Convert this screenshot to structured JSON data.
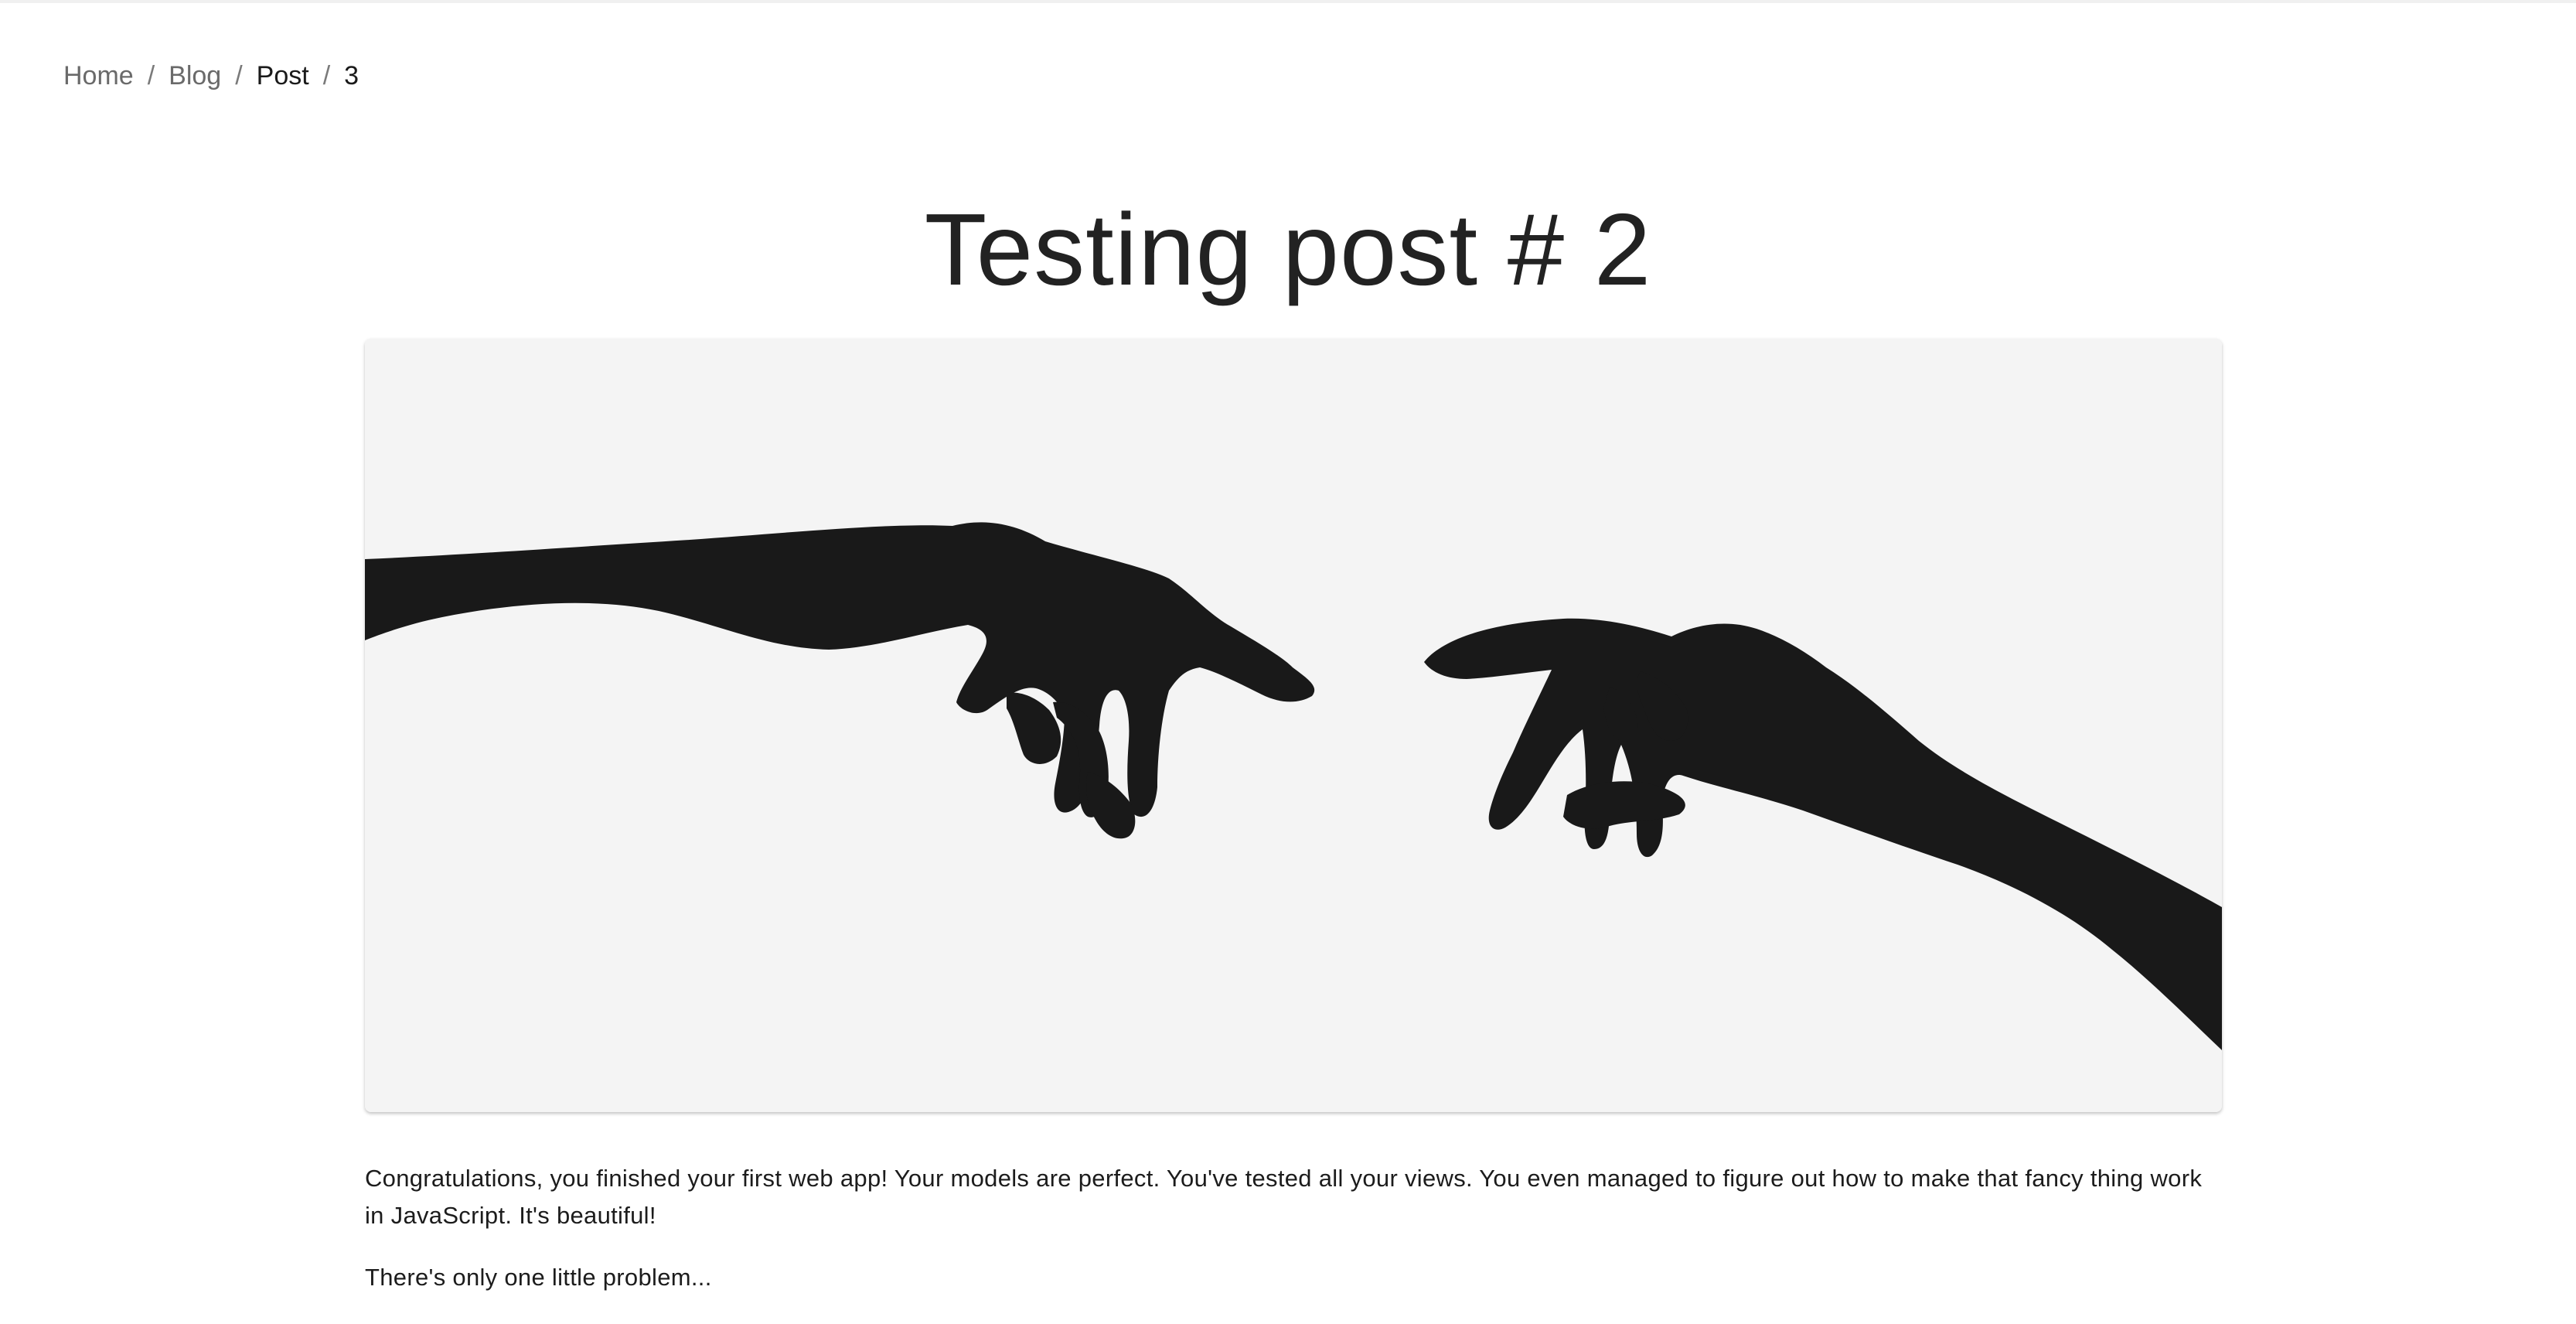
{
  "breadcrumb": {
    "items": [
      {
        "label": "Home"
      },
      {
        "label": "Blog"
      },
      {
        "label": "Post"
      },
      {
        "label": "3"
      }
    ],
    "separator": "/"
  },
  "post": {
    "title": "Testing post # 2",
    "hero_image": {
      "icon": "hands-reaching-image",
      "background": "#f4f4f4",
      "silhouette": "#151515"
    },
    "paragraphs": [
      "Congratulations, you finished your first web app! Your models are perfect. You've tested all your views. You even managed to figure out how to make that fancy thing work in JavaScript. It's beautiful!",
      "There's only one little problem..."
    ]
  }
}
